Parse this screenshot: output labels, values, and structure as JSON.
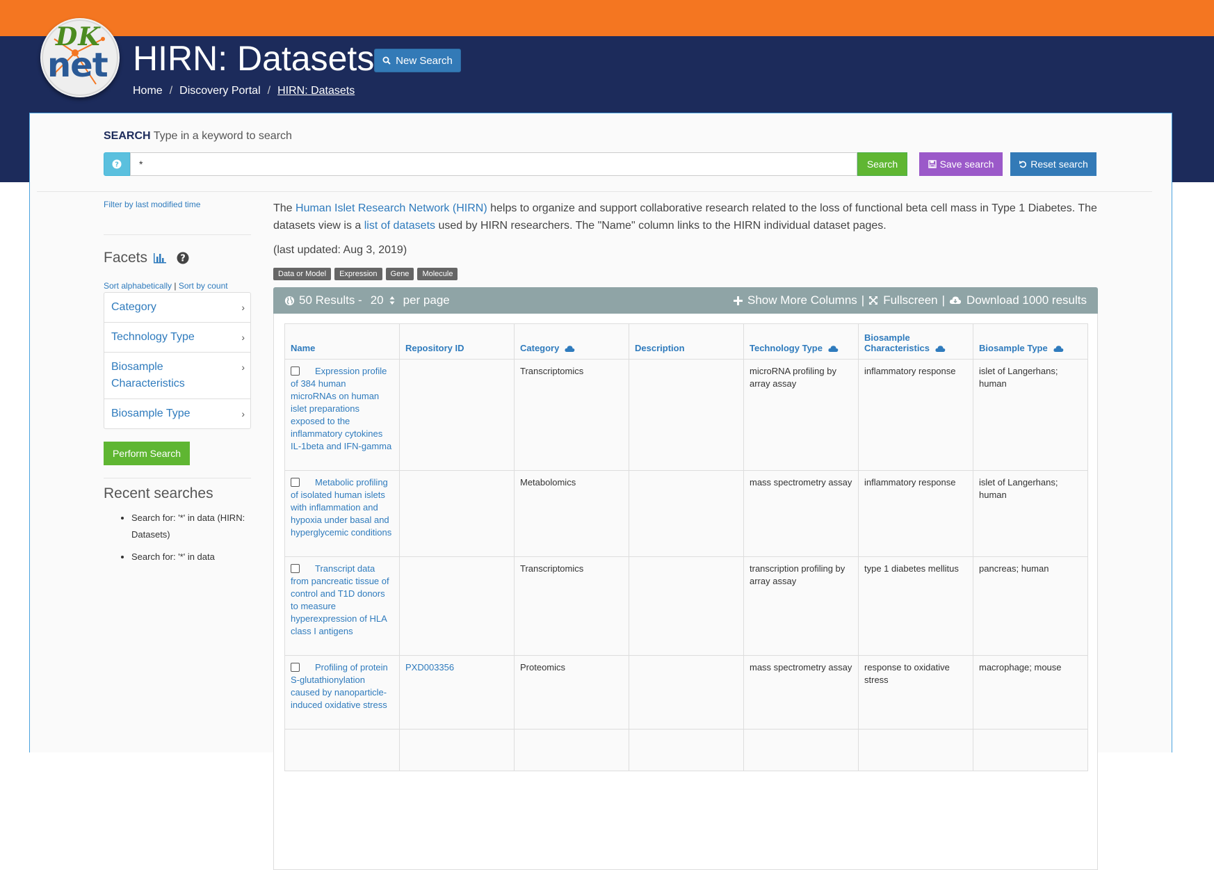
{
  "header": {
    "logo_top": "DK",
    "logo_bottom": "net",
    "title": "HIRN: Datasets",
    "new_search_label": "New Search",
    "breadcrumb": [
      "Home",
      "Discovery Portal",
      "HIRN: Datasets"
    ]
  },
  "search": {
    "label_strong": "SEARCH",
    "label_rest": "Type in a keyword to search",
    "value": "*",
    "search_button": "Search",
    "save_button": "Save search",
    "reset_button": "Reset search"
  },
  "sidebar": {
    "filter_link": "Filter by last modified time",
    "facets_title": "Facets",
    "sort_alpha": "Sort alphabetically",
    "sort_sep": "|",
    "sort_count": "Sort by count",
    "facets": [
      "Category",
      "Technology Type",
      "Biosample Characteristics",
      "Biosample Type"
    ],
    "perform_button": "Perform Search",
    "recent_title": "Recent searches",
    "recent": [
      "Search for: '*' in data (HIRN: Datasets)",
      "Search for: '*' in data"
    ]
  },
  "main": {
    "intro_1": "The ",
    "intro_link1": "Human Islet Research Network (HIRN)",
    "intro_2": " helps to organize and support collaborative research related to the loss of functional beta cell mass in Type 1 Diabetes. The datasets view is a ",
    "intro_link2": "list of datasets",
    "intro_3": " used by HIRN researchers. The \"Name\" column links to the HIRN individual dataset pages.",
    "updated": "(last updated: Aug 3, 2019)",
    "tags": [
      "Data or Model",
      "Expression",
      "Gene",
      "Molecule"
    ],
    "results_label": "50 Results -",
    "per_page_value": "20",
    "per_page_label": "per page",
    "show_more": "Show More Columns",
    "fullscreen": "Fullscreen",
    "download": "Download 1000 results",
    "bar_sep": "|"
  },
  "table": {
    "columns": [
      "Name",
      "Repository ID",
      "Category",
      "Description",
      "Technology Type",
      "Biosample Characteristics",
      "Biosample Type"
    ],
    "rows": [
      {
        "name": "Expression profile of 384 human microRNAs on human islet preparations exposed to the inflammatory cytokines IL-1beta and IFN-gamma",
        "repo": "",
        "category": "Transcriptomics",
        "description": "",
        "tech": "microRNA profiling by array assay",
        "char": "inflammatory response",
        "type": "islet of Langerhans; human"
      },
      {
        "name": "Metabolic profiling of isolated human islets with inflammation and hypoxia under basal and hyperglycemic conditions",
        "repo": "",
        "category": "Metabolomics",
        "description": "",
        "tech": "mass spectrometry assay",
        "char": "inflammatory response",
        "type": "islet of Langerhans; human"
      },
      {
        "name": "Transcript data from pancreatic tissue of control and T1D donors to measure hyperexpression of HLA class I antigens",
        "repo": "",
        "category": "Transcriptomics",
        "description": "",
        "tech": "transcription profiling by array assay",
        "char": "type 1 diabetes mellitus",
        "type": "pancreas; human"
      },
      {
        "name": "Profiling of protein S-glutathionylation caused by nanoparticle-induced oxidative stress",
        "repo": "PXD003356",
        "category": "Proteomics",
        "description": "",
        "tech": "mass spectrometry assay",
        "char": "response to oxidative stress",
        "type": "macrophage; mouse"
      }
    ]
  },
  "colors": {
    "top_bar": "#f47621",
    "nav_band": "#1c2b5b",
    "primary": "#337ab7",
    "success": "#5fb632",
    "save": "#9b59c9",
    "info": "#5bc0de",
    "results_bar": "#8fa4a6",
    "link": "#2f7bbd"
  }
}
